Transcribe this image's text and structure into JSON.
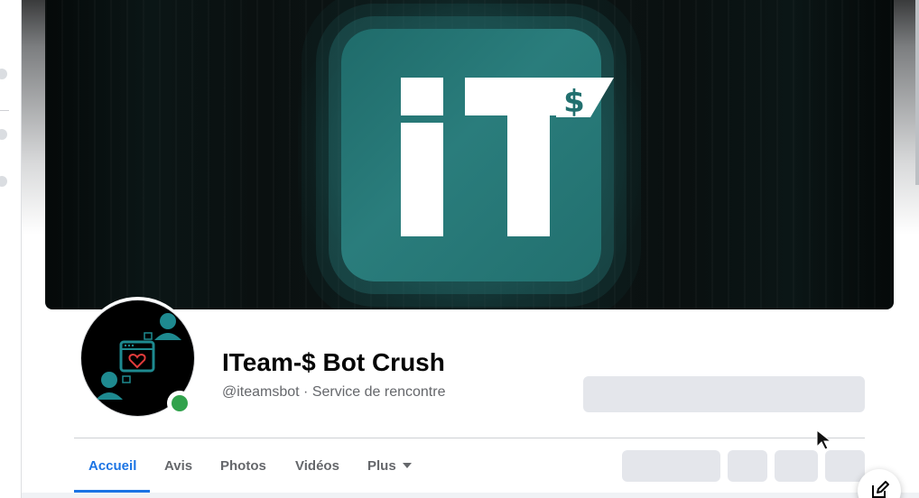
{
  "page": {
    "name": "ITeam-$ Bot Crush",
    "handle": "@iteamsbot · Service de rencontre"
  },
  "tabs": [
    {
      "label": "Accueil",
      "active": true
    },
    {
      "label": "Avis"
    },
    {
      "label": "Photos"
    },
    {
      "label": "Vidéos"
    },
    {
      "label": "Plus"
    }
  ],
  "icons": {
    "cover_logo": "iteam-logo",
    "avatar": "dating-bot-avatar-icon",
    "online": "online-status-dot",
    "more": "caret-down-icon",
    "compose": "compose-message-icon"
  },
  "colors": {
    "accent": "#1b74e4",
    "online": "#31a24c",
    "teal": "#2a7d7c"
  }
}
